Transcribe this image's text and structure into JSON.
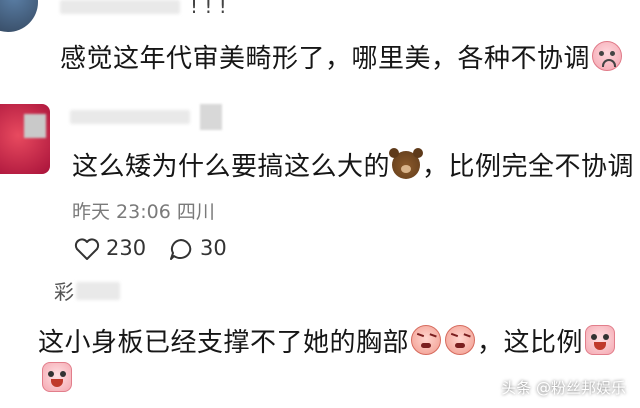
{
  "comments": [
    {
      "top_marks": "! ! !",
      "text": "感觉这年代审美畸形了，哪里美，各种不协调",
      "emoji": "sad-face-emoji"
    },
    {
      "text_before_emoji": "这么矮为什么要搞这么大的",
      "text_after_emoji": "，比例完全不协调",
      "emoji": "bear-emoji",
      "meta": "昨天 23:06 四川",
      "likes": "230",
      "replies": "30"
    },
    {
      "username_partial": "彩",
      "text_line1_before": "这小身板已经支撑不了她的胸部",
      "text_line1_after": "，这比例",
      "emojis": [
        "angry-face-emoji",
        "angry-face-emoji",
        "crying-face-emoji",
        "crying-face-emoji"
      ]
    }
  ],
  "watermark": "头条 @粉丝邦娱乐"
}
